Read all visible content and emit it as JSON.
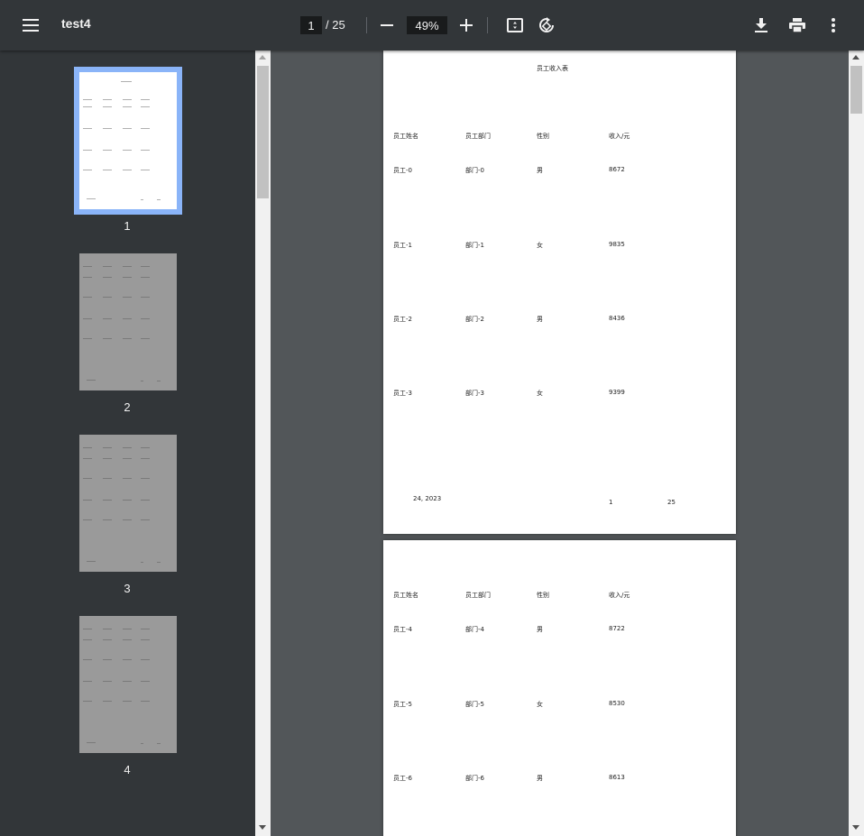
{
  "toolbar": {
    "title": "test4",
    "current_page": "1",
    "page_total": "/ 25",
    "zoom": "49%",
    "icons": [
      "menu-icon",
      "zoom-out-icon",
      "zoom-in-icon",
      "fit-page-icon",
      "rotate-icon",
      "download-icon",
      "print-icon",
      "more-vert-icon"
    ]
  },
  "sidebar": {
    "thumbnails": [
      {
        "label": "1"
      },
      {
        "label": "2"
      },
      {
        "label": "3"
      },
      {
        "label": "4"
      }
    ]
  },
  "page1": {
    "title": "员工收入表",
    "headers": [
      "员工姓名",
      "员工部门",
      "性别",
      "收入/元"
    ],
    "rows": [
      [
        "员工-0",
        "部门-0",
        "男",
        "8672"
      ],
      [
        "员工-1",
        "部门-1",
        "女",
        "9835"
      ],
      [
        "员工-2",
        "部门-2",
        "男",
        "8436"
      ],
      [
        "员工-3",
        "部门-3",
        "女",
        "9399"
      ]
    ],
    "footer_date": "24, 2023",
    "footer_page": "1",
    "footer_total": "25"
  },
  "page2": {
    "headers": [
      "员工姓名",
      "员工部门",
      "性别",
      "收入/元"
    ],
    "rows": [
      [
        "员工-4",
        "部门-4",
        "男",
        "8722"
      ],
      [
        "员工-5",
        "部门-5",
        "女",
        "8530"
      ],
      [
        "员工-6",
        "部门-6",
        "男",
        "8613"
      ]
    ]
  },
  "colors": {
    "toolbar_bg": "#323639",
    "viewer_bg": "#525659",
    "active_thumb_border": "#8ab4f8"
  }
}
